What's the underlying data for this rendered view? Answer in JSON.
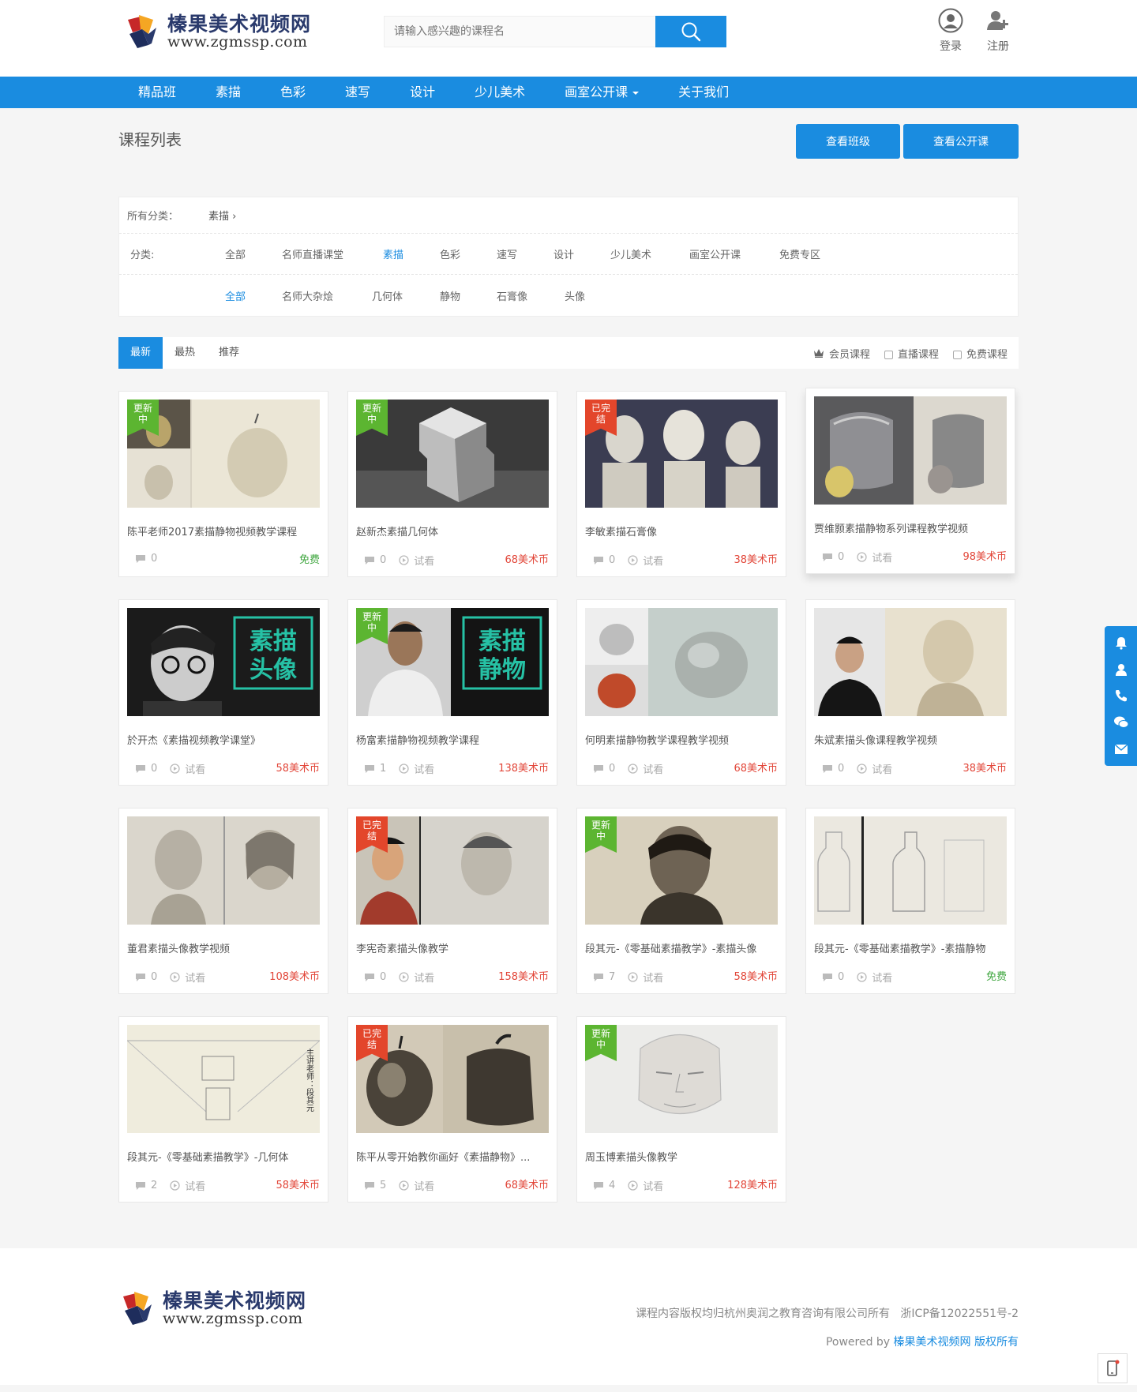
{
  "brand": {
    "name_cn": "榛果美术视频网",
    "domain": "www.zgmssp.com"
  },
  "search": {
    "placeholder": "请输入感兴趣的课程名"
  },
  "user": {
    "login": "登录",
    "register": "注册"
  },
  "nav": [
    "精品班",
    "素描",
    "色彩",
    "速写",
    "设计",
    "少儿美术",
    "画室公开课",
    "关于我们"
  ],
  "page": {
    "title": "课程列表",
    "btn_class": "查看班级",
    "btn_public": "查看公开课"
  },
  "filter": {
    "crumb_label": "所有分类：",
    "crumb_value": "素描 ›",
    "cat_label": "分类:",
    "categories": [
      "全部",
      "名师直播课堂",
      "素描",
      "色彩",
      "速写",
      "设计",
      "少儿美术",
      "画室公开课",
      "免费专区"
    ],
    "subcategories": [
      "全部",
      "名师大杂烩",
      "几何体",
      "静物",
      "石膏像",
      "头像"
    ]
  },
  "sort": {
    "tabs": [
      "最新",
      "最热",
      "推荐"
    ],
    "vip": "会员课程",
    "live": "直播课程",
    "free": "免费课程"
  },
  "courses": [
    {
      "title": "陈平老师2017素描静物视频教学课程",
      "comments": "0",
      "trial": "",
      "price": "免费",
      "ribbon": "更新中"
    },
    {
      "title": "赵新杰素描几何体",
      "comments": "0",
      "trial": "试看",
      "price": "68美术币",
      "ribbon": "更新中"
    },
    {
      "title": "李敏素描石膏像",
      "comments": "0",
      "trial": "试看",
      "price": "38美术币",
      "ribbon": "已完结"
    },
    {
      "title": "贾维颢素描静物系列课程教学视频",
      "comments": "0",
      "trial": "试看",
      "price": "98美术币",
      "ribbon": ""
    },
    {
      "title": "於开杰《素描视频教学课堂》",
      "comments": "0",
      "trial": "试看",
      "price": "58美术币",
      "ribbon": "",
      "overlay": "素描头像"
    },
    {
      "title": "杨富素描静物视频教学课程",
      "comments": "1",
      "trial": "试看",
      "price": "138美术币",
      "ribbon": "更新中",
      "overlay": "素描静物"
    },
    {
      "title": "何明素描静物教学课程教学视频",
      "comments": "0",
      "trial": "试看",
      "price": "68美术币",
      "ribbon": ""
    },
    {
      "title": "朱斌素描头像课程教学视频",
      "comments": "0",
      "trial": "试看",
      "price": "38美术币",
      "ribbon": ""
    },
    {
      "title": "董君素描头像教学视频",
      "comments": "0",
      "trial": "试看",
      "price": "108美术币",
      "ribbon": ""
    },
    {
      "title": "李宪奇素描头像教学",
      "comments": "0",
      "trial": "试看",
      "price": "158美术币",
      "ribbon": "已完结"
    },
    {
      "title": "段其元-《零基础素描教学》-素描头像",
      "comments": "7",
      "trial": "试看",
      "price": "58美术币",
      "ribbon": "更新中"
    },
    {
      "title": "段其元-《零基础素描教学》-素描静物",
      "comments": "0",
      "trial": "试看",
      "price": "免费",
      "ribbon": ""
    },
    {
      "title": "段其元-《零基础素描教学》-几何体",
      "comments": "2",
      "trial": "试看",
      "price": "58美术币",
      "ribbon": ""
    },
    {
      "title": "陈平从零开始教你画好《素描静物》...",
      "comments": "5",
      "trial": "试看",
      "price": "68美术币",
      "ribbon": "已完结"
    },
    {
      "title": "周玉博素描头像教学",
      "comments": "4",
      "trial": "试看",
      "price": "128美术币",
      "ribbon": "更新中"
    }
  ],
  "footer": {
    "copyright": "课程内容版权均归杭州奥润之教育咨询有限公司所有",
    "icp": "浙ICP备12022551号-2",
    "powered": "Powered by",
    "powered_link": "榛果美术视频网 版权所有"
  },
  "colors": {
    "primary": "#1a8ce0",
    "price": "#e2473a",
    "free": "#3fa63f",
    "ribbon_green": "#5cb531",
    "ribbon_red": "#e3462b"
  },
  "icons": [
    "search-icon",
    "user-circle-icon",
    "user-add-icon",
    "comment-icon",
    "play-icon",
    "crown-icon",
    "bell-icon",
    "user-support-icon",
    "phone-icon",
    "wechat-icon",
    "mail-icon",
    "mobile-icon"
  ]
}
